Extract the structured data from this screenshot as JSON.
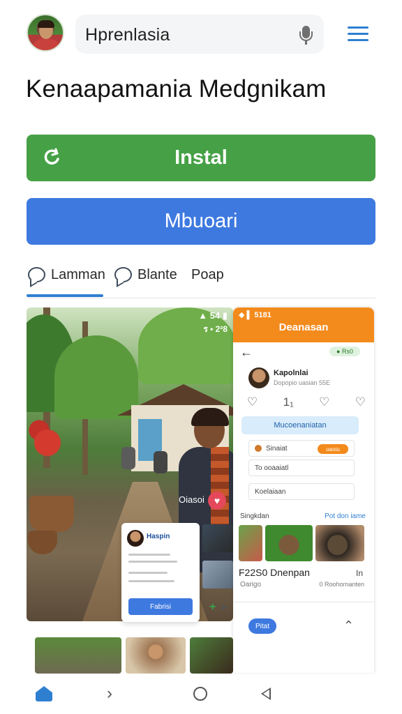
{
  "header": {
    "search_text": "Hprenlasia",
    "menu_icon": "hamburger-menu-icon",
    "mic_icon": "microphone-icon",
    "accent_color": "#2f7fd1"
  },
  "app": {
    "title": "Kenaapamania Medgnikam"
  },
  "buttons": {
    "install_label": "Instal",
    "install_color": "#46a146",
    "open_label": "Mbuoari",
    "open_color": "#3e79e0"
  },
  "tabs": [
    {
      "label": "Lamman",
      "icon": "chat-bubble-icon",
      "active": true
    },
    {
      "label": "Blante",
      "icon": "chat-bubble-icon",
      "active": false
    },
    {
      "label": "Poap",
      "icon": "",
      "active": false
    }
  ],
  "screenshot1": {
    "status_top": "▲ 54 ▮",
    "status_time": "ร • 2²8",
    "overlay_tag": "Oiasoi",
    "mini_card_name": "Haspin",
    "mini_card_button": "Fabrisi"
  },
  "screenshot2": {
    "status": "◆ ▌ 5181",
    "title": "Deanasan",
    "pill": "● Rs0",
    "profile_name": "Kapolnlai",
    "profile_sub": "Dopopio uasian 55E",
    "icon_counts": "1₁",
    "blue_button": "Mucoenaniatan",
    "row1": "Sinaiat",
    "row1_badge": "uaoiu",
    "row2": "To ooaaiatl",
    "row3": "Koelaiaan",
    "section_left": "Singkdan",
    "section_right": "Pot don iame",
    "price": "F22S0 Dnenpan",
    "price_right": "In",
    "small_left": "Oarigo",
    "small_right": "0 Roohornanten",
    "bottom_button": "Pitat"
  },
  "navbar": {
    "items": [
      "home-icon",
      "chevron-right-icon",
      "circle-home-icon",
      "back-triangle-icon"
    ]
  }
}
